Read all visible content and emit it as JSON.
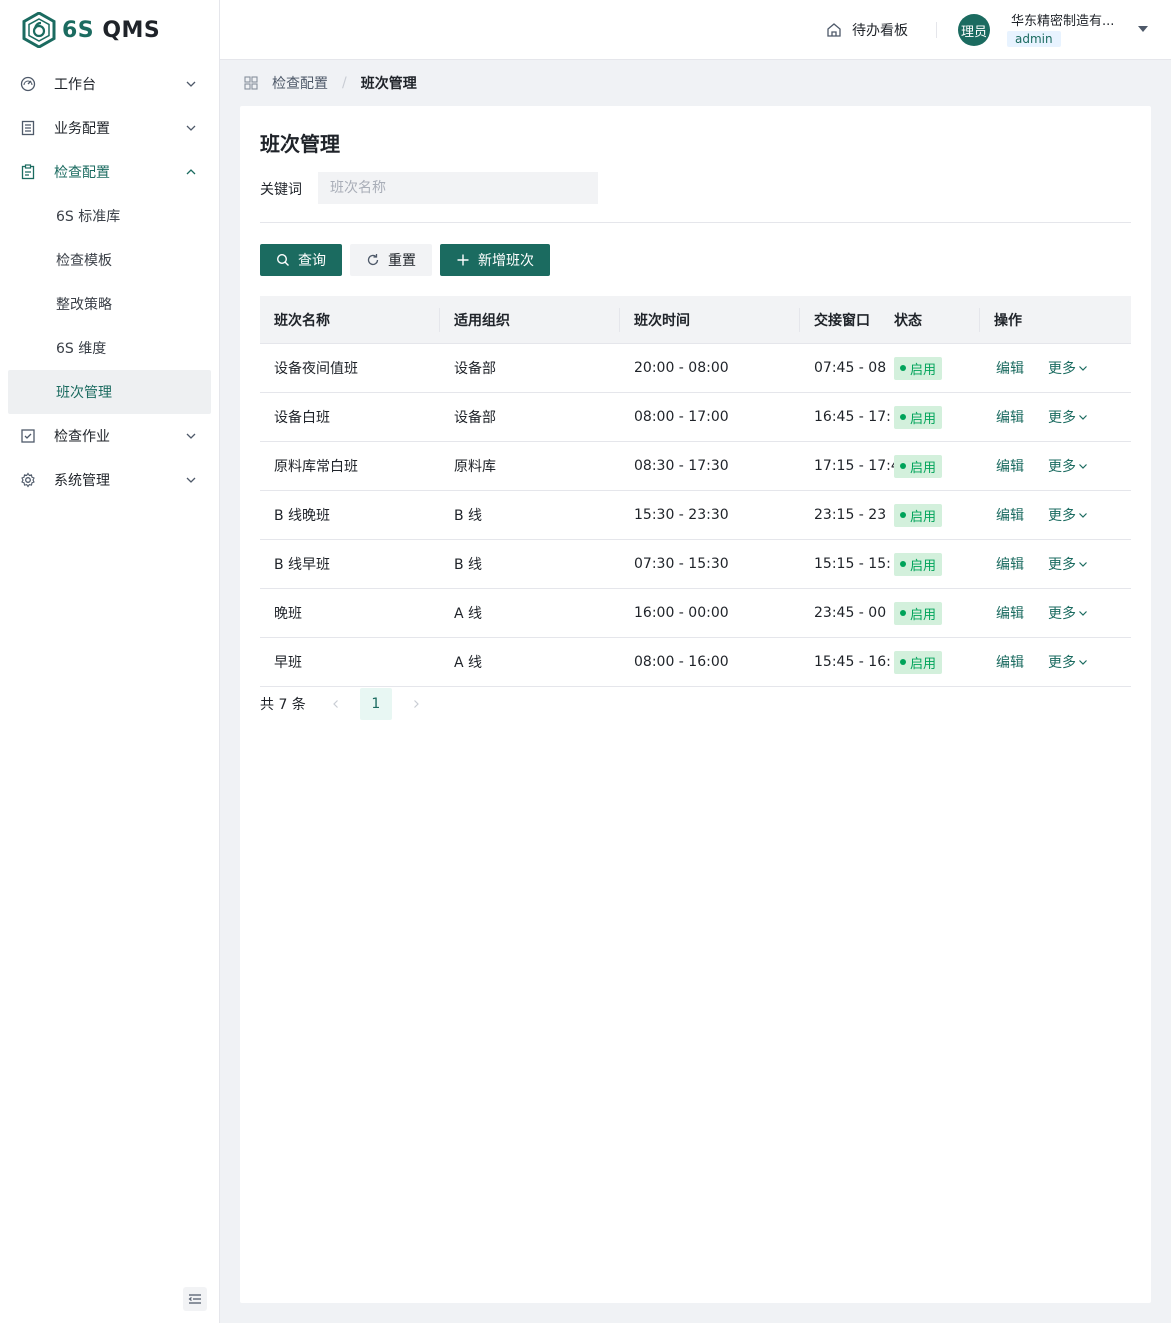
{
  "brand": {
    "logo_num": "6S",
    "logo_name": "QMS"
  },
  "sidebar": {
    "items": [
      {
        "label": "工作台",
        "icon": "dashboard-icon"
      },
      {
        "label": "业务配置",
        "icon": "ledger-icon"
      },
      {
        "label": "检查配置",
        "icon": "clipboard-icon",
        "open": true,
        "children": [
          {
            "label": "6S 标准库"
          },
          {
            "label": "检查模板"
          },
          {
            "label": "整改策略"
          },
          {
            "label": "6S 维度"
          },
          {
            "label": "班次管理",
            "active": true
          }
        ]
      },
      {
        "label": "检查作业",
        "icon": "checkbox-icon"
      },
      {
        "label": "系统管理",
        "icon": "gear-icon"
      }
    ]
  },
  "header": {
    "todo_label": "待办看板",
    "avatar_text": "理员",
    "org_name": "华东精密制造有...",
    "role": "admin"
  },
  "breadcrumb": {
    "parent": "检查配置",
    "separator": "/",
    "current": "班次管理"
  },
  "page": {
    "title": "班次管理",
    "keyword_label": "关键词",
    "keyword_placeholder": "班次名称",
    "keyword_value": "",
    "buttons": {
      "query": "查询",
      "reset": "重置",
      "add": "新增班次"
    }
  },
  "table": {
    "columns": [
      "班次名称",
      "适用组织",
      "班次时间",
      "交接窗口",
      "状态",
      "操作"
    ],
    "rows": [
      {
        "name": "设备夜间值班",
        "org": "设备部",
        "time": "20:00 - 08:00",
        "window": "07:45 - 08",
        "status": "启用"
      },
      {
        "name": "设备白班",
        "org": "设备部",
        "time": "08:00 - 17:00",
        "window": "16:45 - 17:",
        "status": "启用"
      },
      {
        "name": "原料库常白班",
        "org": "原料库",
        "time": "08:30 - 17:30",
        "window": "17:15 - 17:4",
        "status": "启用"
      },
      {
        "name": "B 线晚班",
        "org": "B 线",
        "time": "15:30 - 23:30",
        "window": "23:15 - 23",
        "status": "启用"
      },
      {
        "name": "B 线早班",
        "org": "B 线",
        "time": "07:30 - 15:30",
        "window": "15:15 - 15:",
        "status": "启用"
      },
      {
        "name": "晚班",
        "org": "A 线",
        "time": "16:00 - 00:00",
        "window": "23:45 - 00",
        "status": "启用"
      },
      {
        "name": "早班",
        "org": "A 线",
        "time": "08:00 - 16:00",
        "window": "15:45 - 16:",
        "status": "启用"
      }
    ],
    "actions": {
      "edit": "编辑",
      "more": "更多"
    }
  },
  "pagination": {
    "total_text": "共 7 条",
    "current_page": "1"
  },
  "colors": {
    "primary": "#1b6b60",
    "status_bg": "#d3f0dc",
    "status_fg": "#00a35a"
  }
}
